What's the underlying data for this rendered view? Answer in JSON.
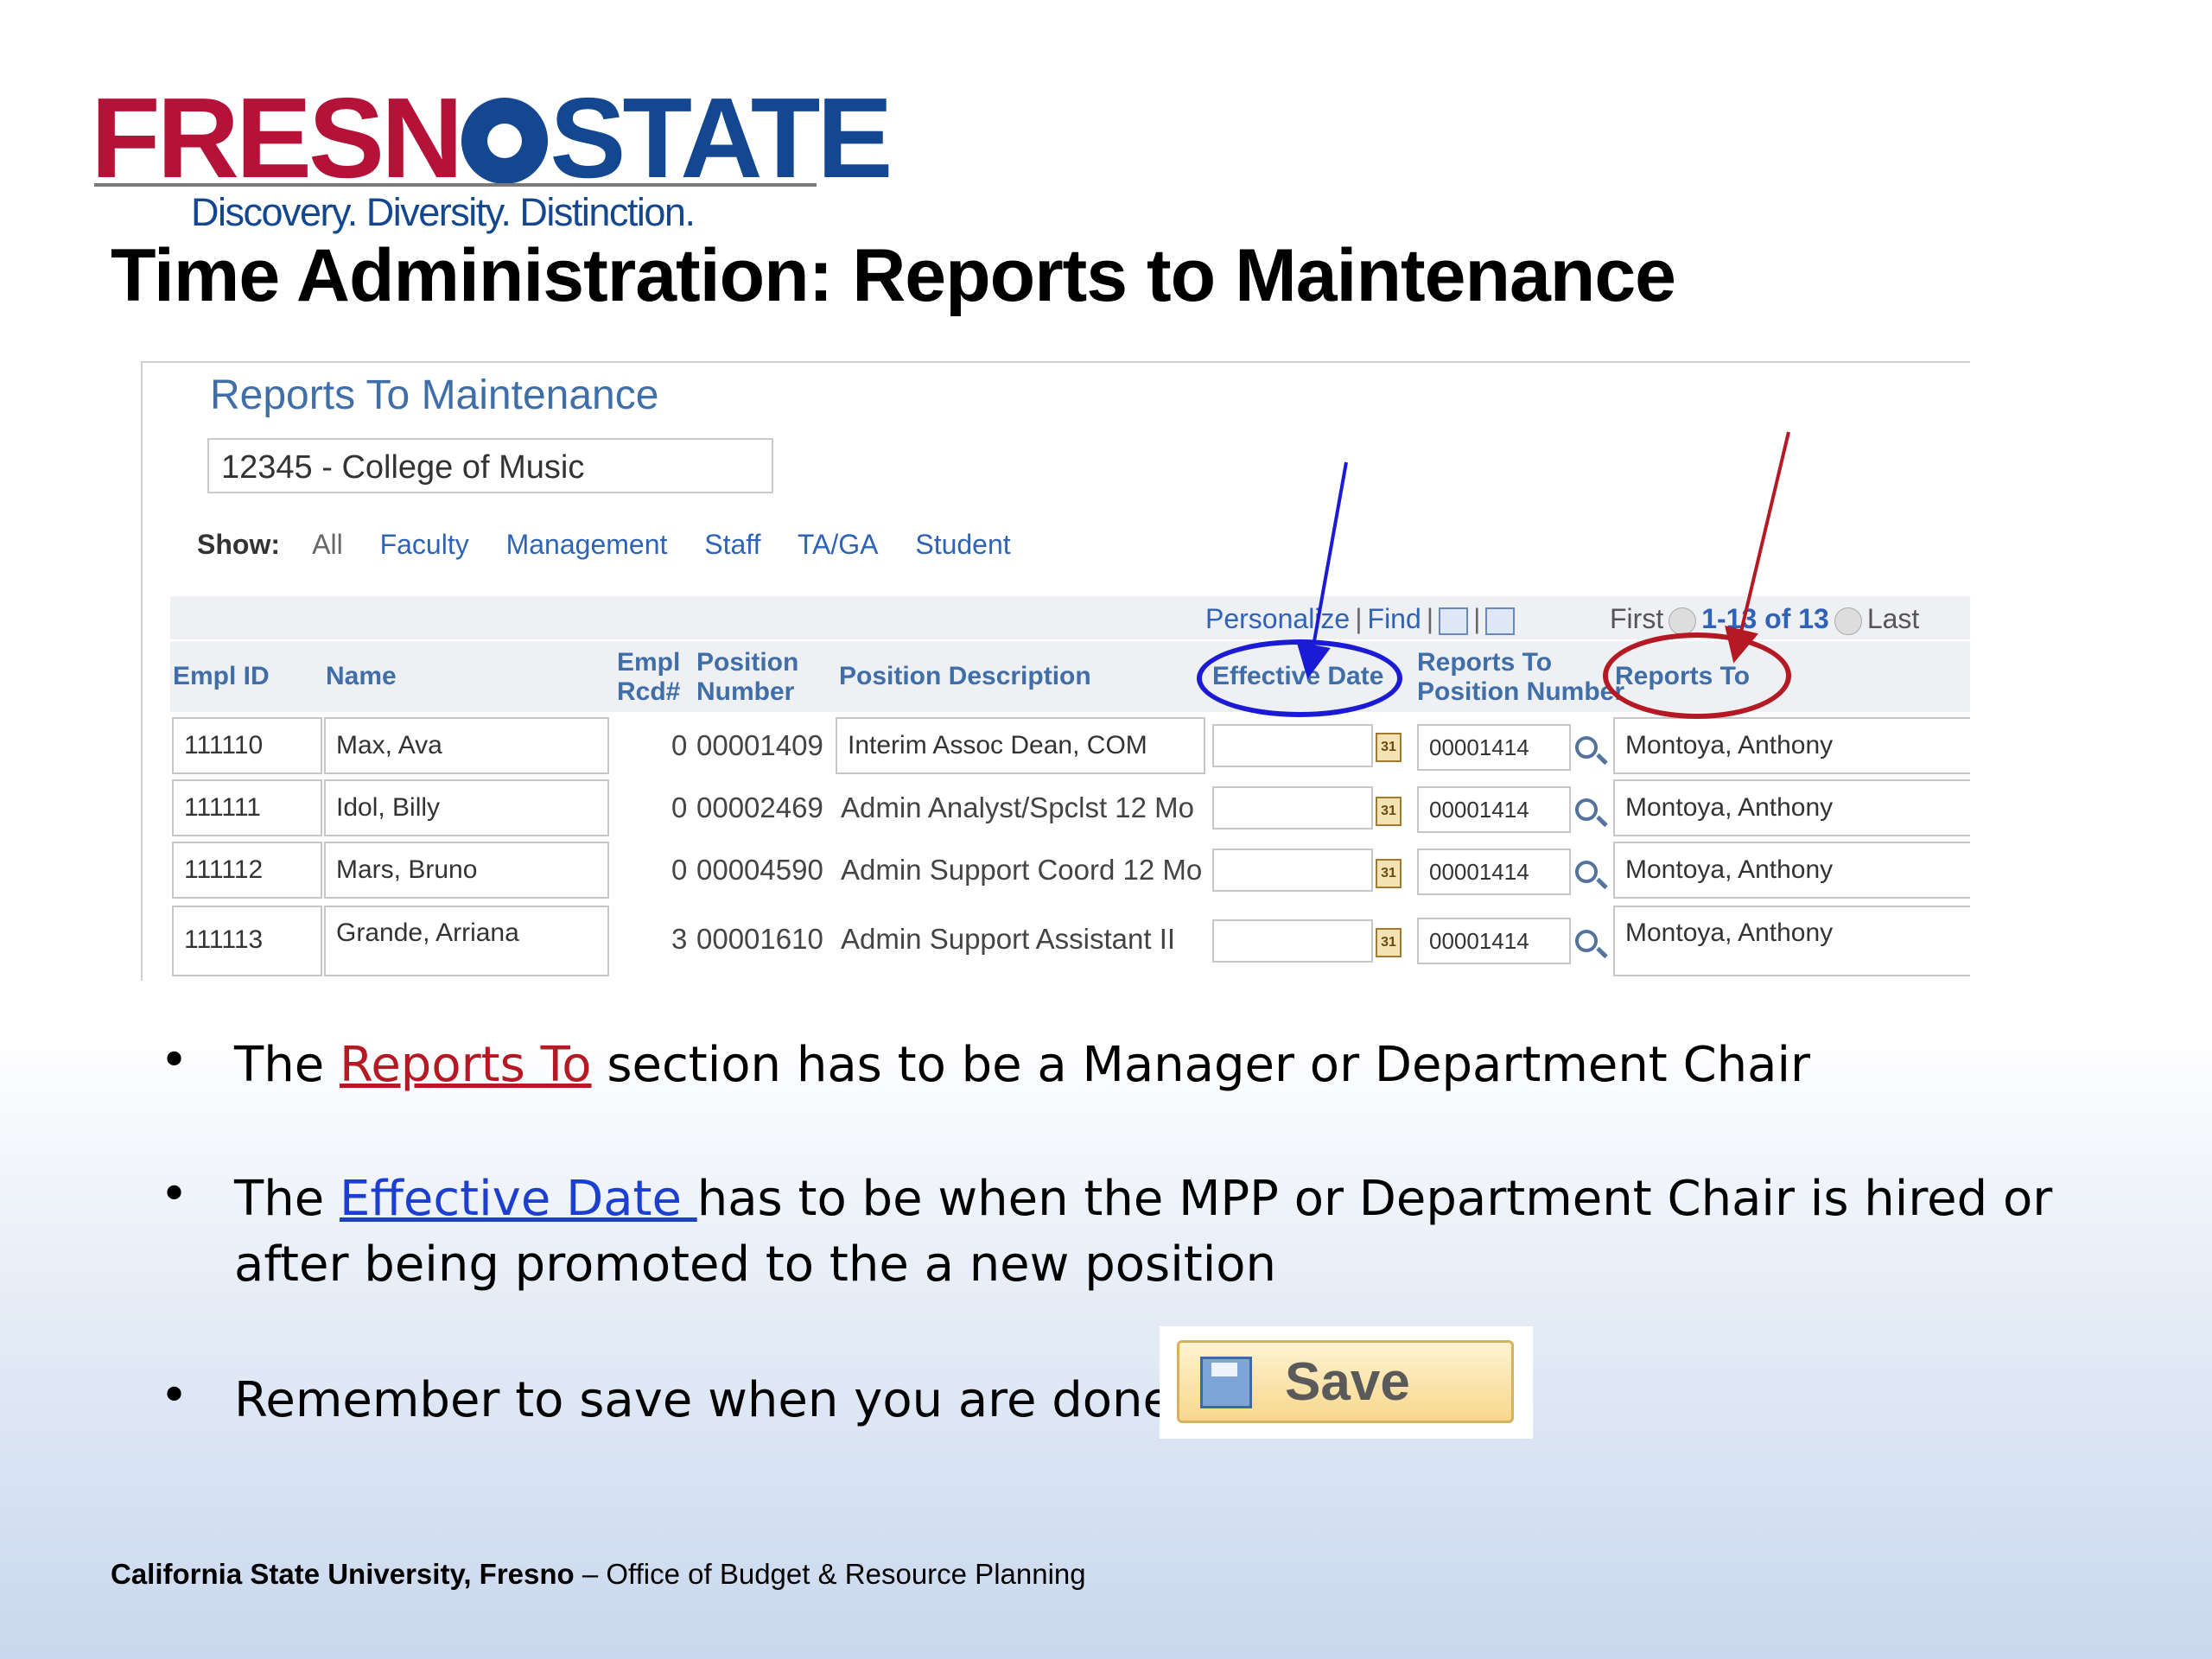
{
  "logo": {
    "word_left": "FRESN",
    "word_right": "STATE",
    "tagline": "Discovery. Diversity. Distinction."
  },
  "slide_title": "Time Administration:  Reports to Maintenance",
  "panel": {
    "title": "Reports To Maintenance",
    "department": "12345 - College of Music",
    "show_label": "Show:",
    "show_options": [
      "All",
      "Faculty",
      "Management",
      "Staff",
      "TA/GA",
      "Student"
    ],
    "grid_nav": {
      "personalize": "Personalize",
      "find": "Find"
    },
    "pager": {
      "first": "First",
      "range": "1-13 of 13",
      "last": "Last"
    },
    "columns": {
      "empl_id": "Empl ID",
      "name": "Name",
      "empl_rcd": [
        "Empl",
        "Rcd#"
      ],
      "position_number": [
        "Position",
        "Number"
      ],
      "position_description": "Position Description",
      "effective_date": "Effective Date",
      "reports_to_position": [
        "Reports To",
        "Position Number"
      ],
      "reports_to": "Reports To"
    },
    "rows": [
      {
        "empl_id": "111110",
        "name": "Max, Ava",
        "rcd": "0",
        "position": "00001409",
        "description": "Interim Assoc Dean, COM",
        "effective_date": "",
        "reports_to_position": "00001414",
        "reports_to": "Montoya, Anthony"
      },
      {
        "empl_id": "111111",
        "name": "Idol, Billy",
        "rcd": "0",
        "position": "00002469",
        "description": "Admin Analyst/Spclst 12 Mo",
        "effective_date": "",
        "reports_to_position": "00001414",
        "reports_to": "Montoya, Anthony"
      },
      {
        "empl_id": "111112",
        "name": "Mars, Bruno",
        "rcd": "0",
        "position": "00004590",
        "description": "Admin Support Coord 12 Mo",
        "effective_date": "",
        "reports_to_position": "00001414",
        "reports_to": "Montoya, Anthony"
      },
      {
        "empl_id": "111113",
        "name": "Grande, Arriana",
        "rcd": "3",
        "position": "00001610",
        "description": "Admin Support Assistant II",
        "effective_date": "",
        "reports_to_position": "00001414",
        "reports_to": "Montoya, Anthony"
      }
    ],
    "annotation_colors": {
      "effective_date": "#1b1bd6",
      "reports_to": "#b51a24"
    }
  },
  "bullets": {
    "b1": {
      "pre": "The ",
      "link": "Reports To",
      "post": " section has to be a Manager or Department Chair"
    },
    "b2": {
      "pre": "The ",
      "link": "Effective Date ",
      "post": "has to be when the MPP or Department Chair is hired or",
      "line2": "after being promoted to the a new position"
    },
    "b3": {
      "text": "Remember to save when you are done"
    },
    "dot": "•"
  },
  "save_button": {
    "label": "Save"
  },
  "footer": {
    "bold": "California State University, Fresno",
    "rest": " – Office of Budget & Resource Planning"
  },
  "icons": [
    "paw-icon",
    "calendar-icon",
    "search-icon",
    "zoom-icon",
    "grid-download-icon",
    "prev-page-icon",
    "next-page-icon",
    "save-disk-icon"
  ]
}
